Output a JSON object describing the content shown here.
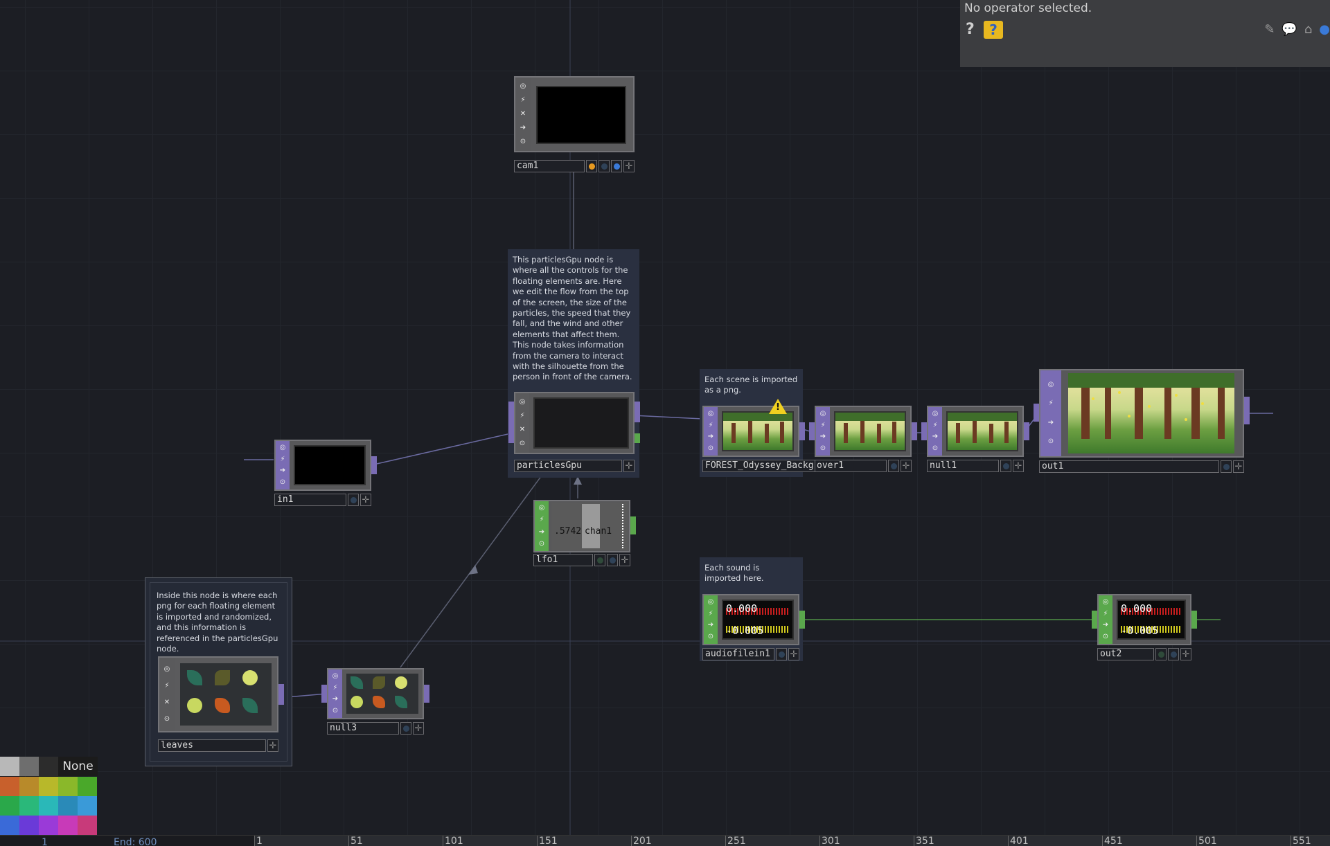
{
  "info_panel": {
    "message": "No operator selected.",
    "help_icon": "question-icon",
    "python_help_icon": "python-help-icon"
  },
  "annotations": {
    "particles": "This particlesGpu node is where all the controls for the floating elements are. Here we edit the flow from the top of the screen, the size of the particles, the speed that they fall, and the wind and other elements that affect them. This node takes information from the camera to interact with the silhouette from the person in front of the camera.",
    "scene": "Each scene is imported as a png.",
    "sound": "Each sound is imported here.",
    "leaves": "Inside this node is where each png for each floating element is imported and randomized, and this information is referenced in the particlesGpu node."
  },
  "nodes": {
    "cam1": "cam1",
    "particlesGpu": "particlesGpu",
    "in1": "in1",
    "lfo1": "lfo1",
    "lfo1_value": ".5742",
    "lfo1_channel": "chan1",
    "forest": "FOREST_Odyssey_Background",
    "over1": "over1",
    "null1": "null1",
    "out1": "out1",
    "audio": "audiofilein1",
    "out2": "out2",
    "leaves": "leaves",
    "null3": "null3",
    "audio_top": "0.000",
    "audio_bottom": "-0.005",
    "out2_top": "0.000",
    "out2_bottom": "-0.005"
  },
  "palette": {
    "none_label": "None",
    "swatches": [
      "#b8b8b8",
      "#6e6e6e",
      "#2c2c2c",
      "#c8602c",
      "#b88a2a",
      "#b8b82a",
      "#8ab82a",
      "#4aa82a",
      "#2aa84a",
      "#2ab87a",
      "#2ab8b8",
      "#2a8ab8",
      "#3a9ad8",
      "#3a6ad8",
      "#6a3ad8",
      "#9a3ad8",
      "#c83ab8",
      "#c83a7a",
      "#b82a4a"
    ]
  },
  "timeline": {
    "ticks": [
      "1",
      "51",
      "101",
      "151",
      "201",
      "251",
      "301",
      "351",
      "401",
      "451",
      "501",
      "551"
    ],
    "start_label": "1",
    "end_label": "End: 600"
  },
  "colors": {
    "top_accent": "#7a6cb4",
    "chop_accent": "#5aa84c",
    "background": "#1c1e24"
  }
}
